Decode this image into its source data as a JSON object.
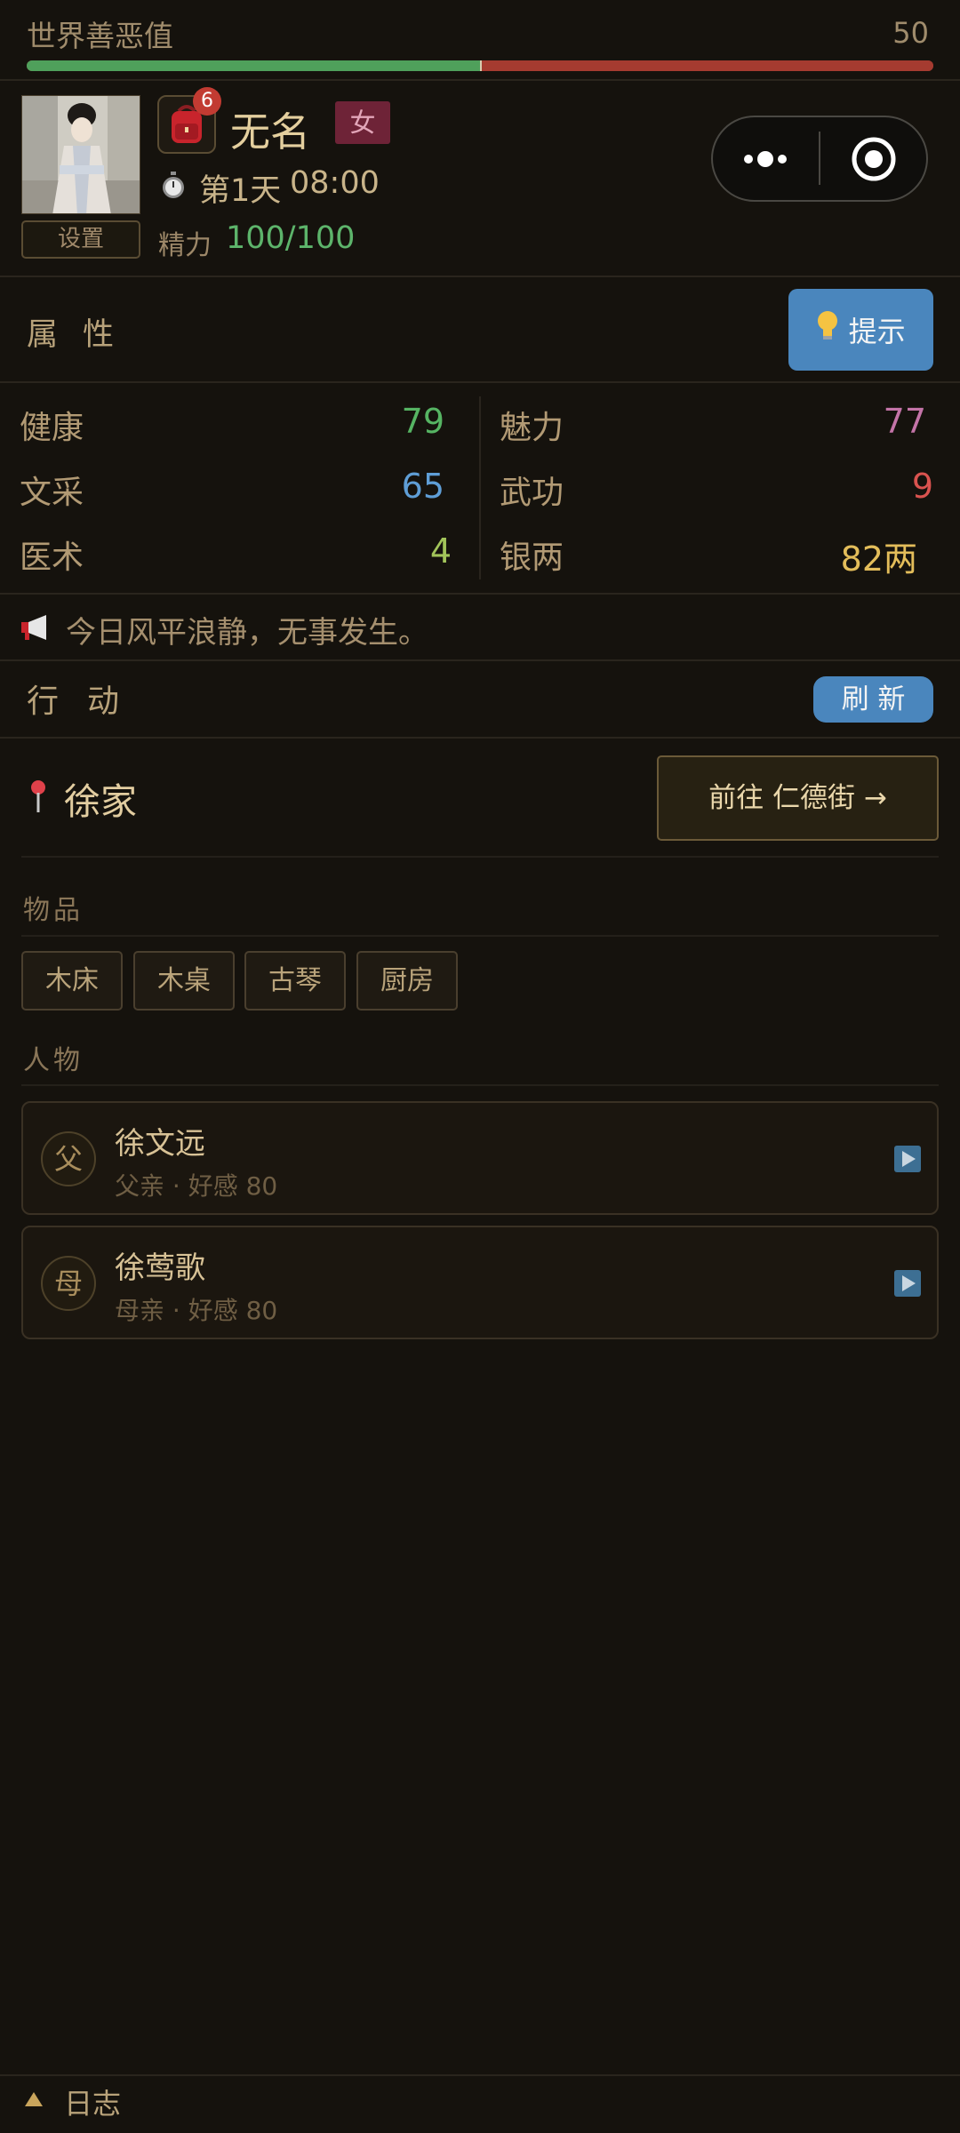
{
  "karma": {
    "label": "世界善恶值",
    "value": "50",
    "fraction": 0.5
  },
  "player": {
    "name": "无名",
    "gender": "女",
    "bag_badge": "6",
    "day": "第1天",
    "time": "08:00",
    "energy_label": "精力",
    "energy_value": "100/100",
    "settings_label": "设置"
  },
  "attributes": {
    "title": "属性",
    "hint_label": "提示",
    "stats": [
      {
        "label": "健康",
        "value": "79",
        "color": "#56b463"
      },
      {
        "label": "魅力",
        "value": "77",
        "color": "#c474a8"
      },
      {
        "label": "文采",
        "value": "65",
        "color": "#5f9ed6"
      },
      {
        "label": "武功",
        "value": "9",
        "color": "#d9534f"
      },
      {
        "label": "医术",
        "value": "4",
        "color": "#a2c45a"
      },
      {
        "label": "银两",
        "value": "82两",
        "color": "#e3bd5a"
      }
    ]
  },
  "event": {
    "text": "今日风平浪静，无事发生。",
    "icon": "megaphone-icon"
  },
  "actions": {
    "title": "行动",
    "refresh_label": "刷 新",
    "location": "徐家",
    "goto_label": "前往 仁德街 →",
    "items_title": "物品",
    "items": [
      "木床",
      "木桌",
      "古琴",
      "厨房"
    ],
    "people_title": "人物",
    "people": [
      {
        "avatar": "父",
        "name": "徐文远",
        "meta": "父亲 · 好感 80"
      },
      {
        "avatar": "母",
        "name": "徐莺歌",
        "meta": "母亲 · 好感 80"
      }
    ]
  },
  "footer": {
    "log_label": "日志"
  }
}
